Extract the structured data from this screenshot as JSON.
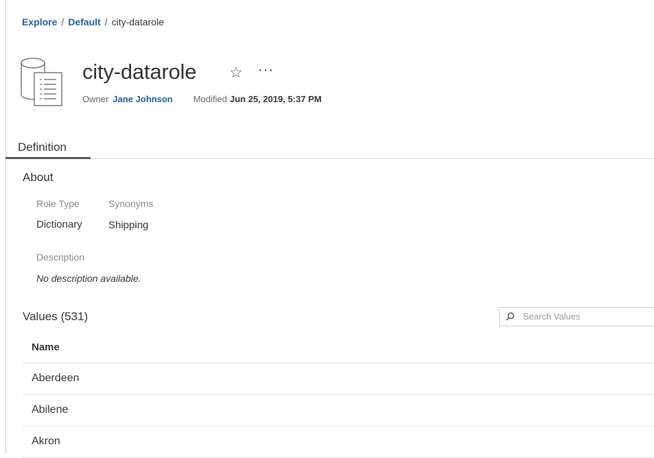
{
  "breadcrumb": {
    "items": [
      "Explore",
      "Default"
    ],
    "separator": "/",
    "current": "city-datarole"
  },
  "header": {
    "title": "city-datarole",
    "icon": "data-role-icon",
    "star_icon": "☆",
    "more_icon": "···",
    "owner_label": "Owner",
    "owner_name": "Jane Johnson",
    "modified_label": "Modified",
    "modified_value": "Jun 25, 2019, 5:37 PM"
  },
  "tabs": [
    {
      "label": "Definition",
      "active": true
    }
  ],
  "about": {
    "heading": "About",
    "role_type_label": "Role Type",
    "role_type_value": "Dictionary",
    "synonyms_label": "Synonyms",
    "synonyms_value": "Shipping",
    "description_label": "Description",
    "description_value": "No description available."
  },
  "values": {
    "heading": "Values (531)",
    "search_placeholder": "Search Values",
    "column_header": "Name",
    "rows": [
      "Aberdeen",
      "Abilene",
      "Akron"
    ]
  },
  "colors": {
    "link": "#1f5d9e",
    "text": "#333333",
    "muted": "#888888",
    "divider": "#d8d8d8"
  }
}
